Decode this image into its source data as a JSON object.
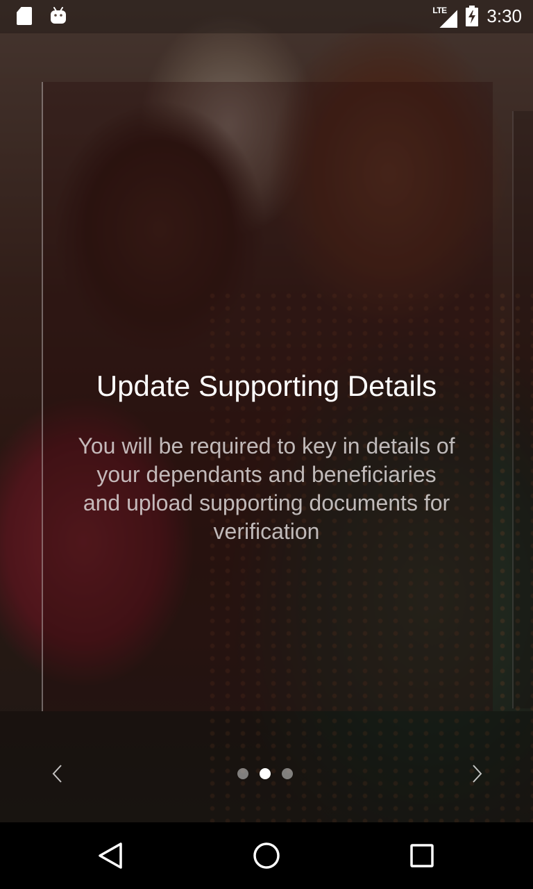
{
  "status_bar": {
    "network_label": "LTE",
    "time": "3:30",
    "icons": [
      "sd-card-icon",
      "android-icon",
      "signal-icon",
      "battery-charging-icon"
    ]
  },
  "onboarding": {
    "title": "Update Supporting Details",
    "description": "You will be required to key in details of your dependants and beneficiaries and upload supporting documents for verification",
    "page_count": 3,
    "current_page": 2
  },
  "nav_bar": {
    "icons": [
      "back-icon",
      "home-icon",
      "recent-apps-icon"
    ]
  },
  "colors": {
    "title": "#ffffff",
    "description": "#dcd7d7",
    "dot_active": "#ffffff",
    "dot_inactive": "#a0a0a0",
    "nav_bar_bg": "#000000"
  }
}
